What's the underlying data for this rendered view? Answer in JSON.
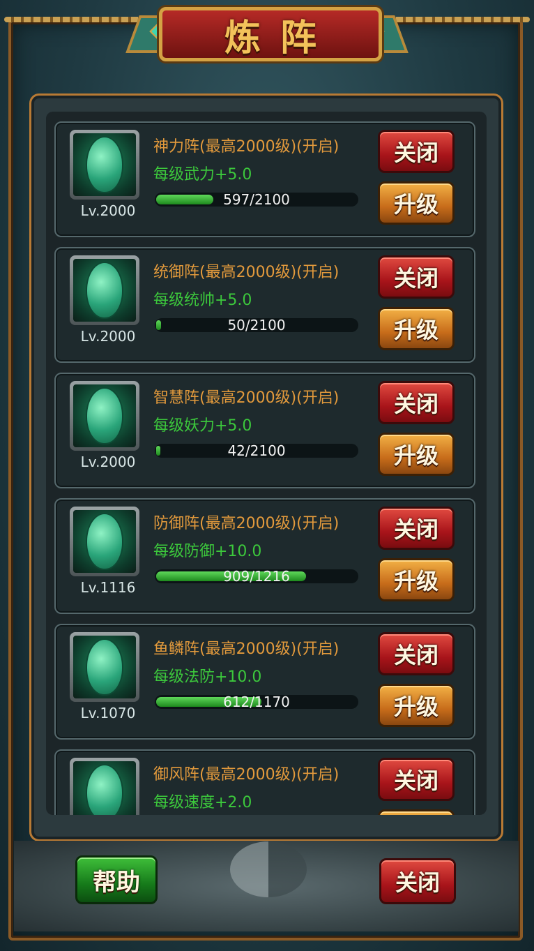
{
  "title": "炼阵",
  "formations": [
    {
      "level": "Lv.2000",
      "name": "神力阵(最高2000级)(开启)",
      "effect": "每级武力+5.0",
      "progress_text": "597/2100",
      "progress": 0.284,
      "close_label": "关闭",
      "upgrade_label": "升级"
    },
    {
      "level": "Lv.2000",
      "name": "统御阵(最高2000级)(开启)",
      "effect": "每级统帅+5.0",
      "progress_text": "50/2100",
      "progress": 0.024,
      "close_label": "关闭",
      "upgrade_label": "升级"
    },
    {
      "level": "Lv.2000",
      "name": "智慧阵(最高2000级)(开启)",
      "effect": "每级妖力+5.0",
      "progress_text": "42/2100",
      "progress": 0.02,
      "close_label": "关闭",
      "upgrade_label": "升级"
    },
    {
      "level": "Lv.1116",
      "name": "防御阵(最高2000级)(开启)",
      "effect": "每级防御+10.0",
      "progress_text": "909/1216",
      "progress": 0.748,
      "close_label": "关闭",
      "upgrade_label": "升级"
    },
    {
      "level": "Lv.1070",
      "name": "鱼鳞阵(最高2000级)(开启)",
      "effect": "每级法防+10.0",
      "progress_text": "612/1170",
      "progress": 0.523,
      "close_label": "关闭",
      "upgrade_label": "升级"
    },
    {
      "level": "",
      "name": "御风阵(最高2000级)(开启)",
      "effect": "每级速度+2.0",
      "progress_text": "",
      "progress": 0,
      "close_label": "关闭",
      "upgrade_label": ""
    }
  ],
  "footer": {
    "help_label": "帮助",
    "close_label": "关闭"
  },
  "colors": {
    "name": "#e39a3c",
    "effect": "#3cc83c",
    "close_button": "#c4201f",
    "upgrade_button": "#d98a2a",
    "help_button": "#1f8f24",
    "frame": "#b87a34"
  }
}
